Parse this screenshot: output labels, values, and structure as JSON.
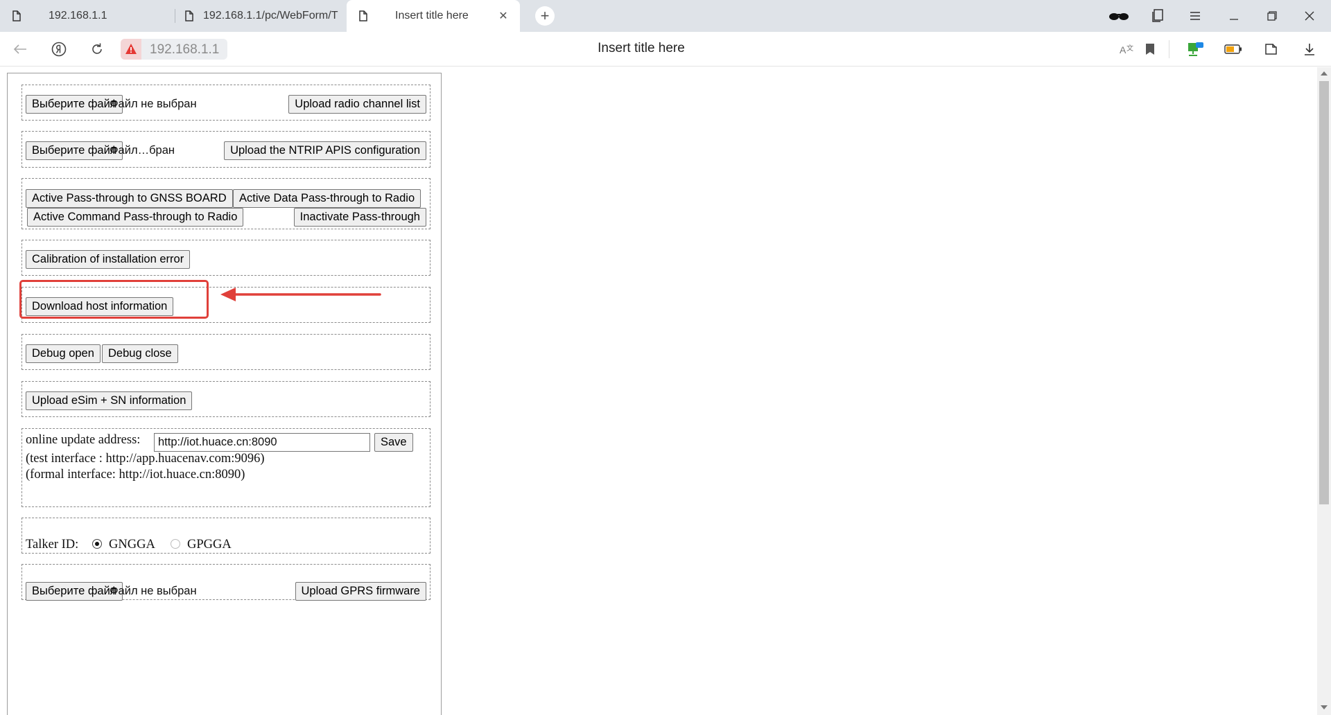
{
  "browser": {
    "tabs": [
      {
        "title": "192.168.1.1",
        "icon": "document-icon"
      },
      {
        "title": "192.168.1.1/pc/WebForm/T",
        "icon": "document-icon"
      },
      {
        "title": "Insert title here",
        "icon": "document-icon",
        "active": true
      }
    ],
    "new_tab": "+",
    "url": "192.168.1.1",
    "page_title": "Insert title here"
  },
  "sections": {
    "radio_channel": {
      "choose_file": "Выберите файл",
      "file_status": "Файл не выбран",
      "upload": "Upload radio channel list"
    },
    "ntrip": {
      "choose_file": "Выберите файл",
      "file_status": "Файл…бран",
      "upload": "Upload the NTRIP APIS configuration"
    },
    "passthrough": {
      "gnss": "Active Pass-through to GNSS BOARD",
      "data_radio": "Active Data Pass-through to Radio",
      "command_radio": "Active Command Pass-through to Radio",
      "inactivate": "Inactivate Pass-through"
    },
    "calibration": {
      "button": "Calibration of installation error"
    },
    "host_info": {
      "button": "Download host information"
    },
    "debug": {
      "open": "Debug open",
      "close": "Debug close"
    },
    "esim": {
      "button": "Upload eSim + SN information"
    },
    "online_update": {
      "label": "online update address:",
      "value": "http://iot.huace.cn:8090",
      "save": "Save",
      "test_note": "(test interface : http://app.huacenav.com:9096)",
      "formal_note": "(formal interface: http://iot.huace.cn:8090)"
    },
    "talker": {
      "label": "Talker ID:",
      "option1": "GNGGA",
      "option2": "GPGGA",
      "selected": "GNGGA"
    },
    "gprs": {
      "choose_file": "Выберите файл",
      "file_status": "Файл не выбран",
      "upload": "Upload GPRS firmware"
    }
  },
  "annotation": {
    "color": "#e0403a"
  }
}
